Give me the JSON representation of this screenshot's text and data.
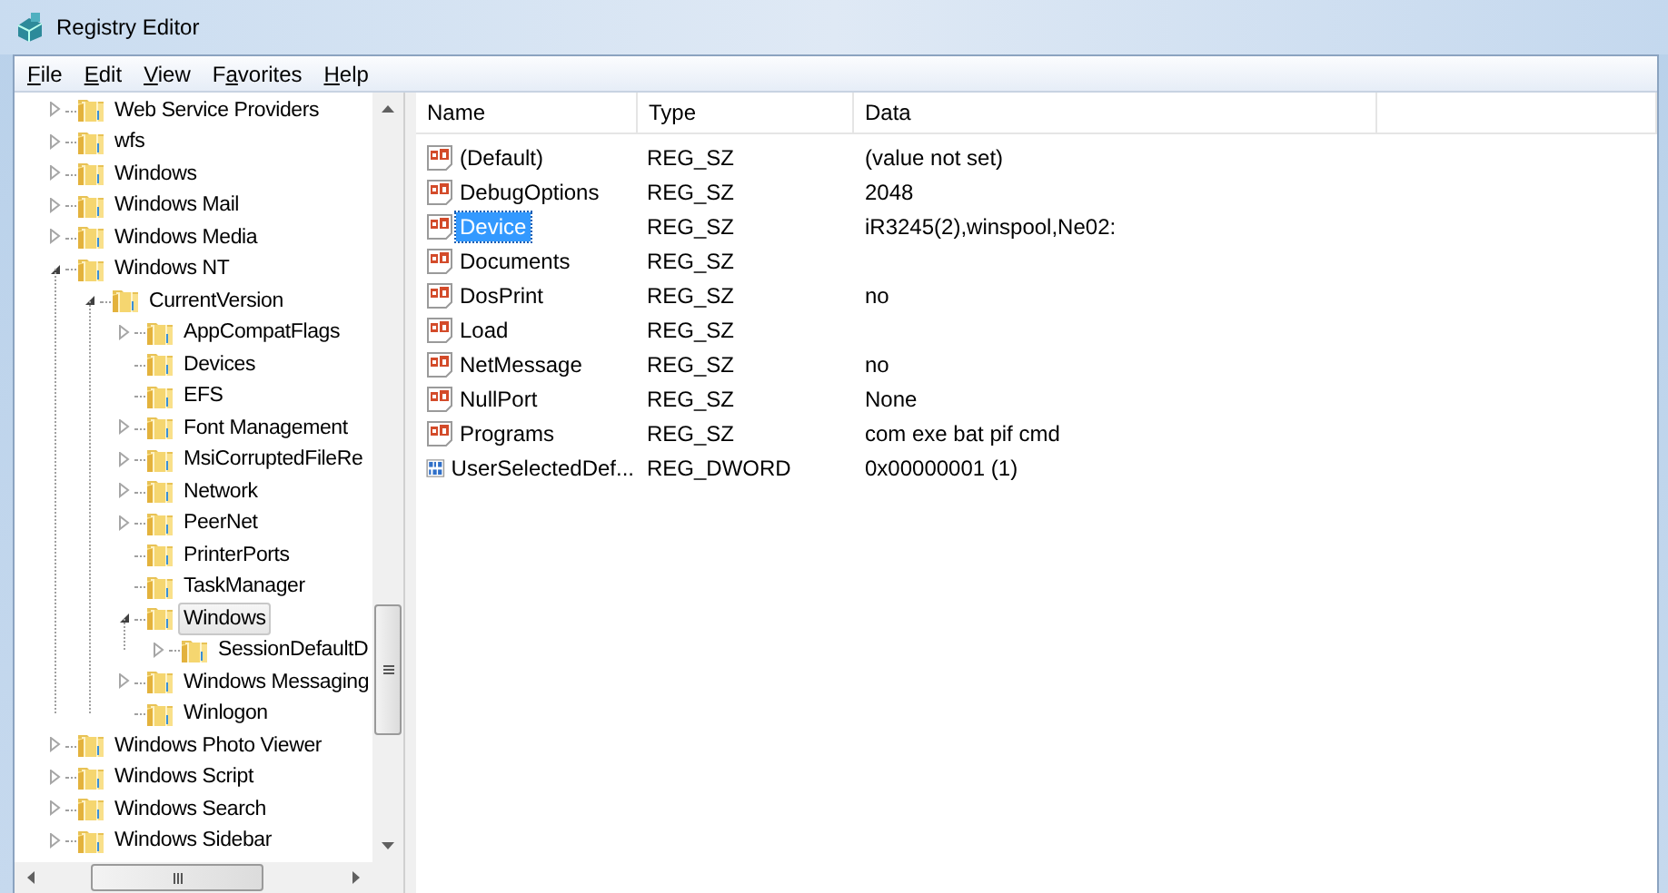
{
  "window": {
    "title": "Registry Editor"
  },
  "menu": [
    {
      "key": "F",
      "post": "ile"
    },
    {
      "key": "E",
      "post": "dit"
    },
    {
      "key": "V",
      "post": "iew"
    },
    {
      "pre": "F",
      "key": "a",
      "post": "vorites"
    },
    {
      "key": "H",
      "post": "elp"
    }
  ],
  "tree": [
    {
      "label": "Web Service Providers",
      "expandable": true,
      "expanded": false,
      "selected": false
    },
    {
      "label": "wfs",
      "expandable": true,
      "expanded": false,
      "selected": false
    },
    {
      "label": "Windows",
      "expandable": true,
      "expanded": false,
      "selected": false
    },
    {
      "label": "Windows Mail",
      "expandable": true,
      "expanded": false,
      "selected": false
    },
    {
      "label": "Windows Media",
      "expandable": true,
      "expanded": false,
      "selected": false
    },
    {
      "label": "Windows NT",
      "expandable": true,
      "expanded": true,
      "selected": false,
      "children": [
        {
          "label": "CurrentVersion",
          "expandable": true,
          "expanded": true,
          "selected": false,
          "children": [
            {
              "label": "AppCompatFlags",
              "expandable": true,
              "expanded": false,
              "selected": false
            },
            {
              "label": "Devices",
              "expandable": false,
              "selected": false
            },
            {
              "label": "EFS",
              "expandable": false,
              "selected": false
            },
            {
              "label": "Font Management",
              "expandable": true,
              "expanded": false,
              "selected": false
            },
            {
              "label": "MsiCorruptedFileRe",
              "expandable": true,
              "expanded": false,
              "selected": false
            },
            {
              "label": "Network",
              "expandable": true,
              "expanded": false,
              "selected": false
            },
            {
              "label": "PeerNet",
              "expandable": true,
              "expanded": false,
              "selected": false
            },
            {
              "label": "PrinterPorts",
              "expandable": false,
              "selected": false
            },
            {
              "label": "TaskManager",
              "expandable": false,
              "selected": false
            },
            {
              "label": "Windows",
              "expandable": true,
              "expanded": true,
              "selected": true,
              "children": [
                {
                  "label": "SessionDefaultD",
                  "expandable": true,
                  "expanded": false,
                  "selected": false
                }
              ]
            },
            {
              "label": "Windows Messaging",
              "expandable": true,
              "expanded": false,
              "selected": false
            },
            {
              "label": "Winlogon",
              "expandable": false,
              "selected": false
            }
          ]
        }
      ]
    },
    {
      "label": "Windows Photo Viewer",
      "expandable": true,
      "expanded": false,
      "selected": false
    },
    {
      "label": "Windows Script",
      "expandable": true,
      "expanded": false,
      "selected": false
    },
    {
      "label": "Windows Search",
      "expandable": true,
      "expanded": false,
      "selected": false
    },
    {
      "label": "Windows Sidebar",
      "expandable": true,
      "expanded": false,
      "selected": false
    }
  ],
  "table": {
    "columns": [
      "Name",
      "Type",
      "Data"
    ],
    "rows": [
      {
        "kind": "string",
        "name": "(Default)",
        "type": "REG_SZ",
        "data": "(value not set)",
        "selected": false
      },
      {
        "kind": "string",
        "name": "DebugOptions",
        "type": "REG_SZ",
        "data": "2048",
        "selected": false
      },
      {
        "kind": "string",
        "name": "Device",
        "type": "REG_SZ",
        "data": "iR3245(2),winspool,Ne02:",
        "selected": true
      },
      {
        "kind": "string",
        "name": "Documents",
        "type": "REG_SZ",
        "selected": false
      },
      {
        "kind": "string",
        "name": "DosPrint",
        "type": "REG_SZ",
        "data": "no",
        "selected": false
      },
      {
        "kind": "string",
        "name": "Load",
        "type": "REG_SZ",
        "selected": false
      },
      {
        "kind": "string",
        "name": "NetMessage",
        "type": "REG_SZ",
        "data": "no",
        "selected": false
      },
      {
        "kind": "string",
        "name": "NullPort",
        "type": "REG_SZ",
        "data": "None",
        "selected": false
      },
      {
        "kind": "string",
        "name": "Programs",
        "type": "REG_SZ",
        "data": "com exe bat pif cmd",
        "selected": false
      },
      {
        "kind": "binary",
        "name": "UserSelectedDef...",
        "type": "REG_DWORD",
        "data": "0x00000001 (1)",
        "selected": false
      }
    ]
  }
}
